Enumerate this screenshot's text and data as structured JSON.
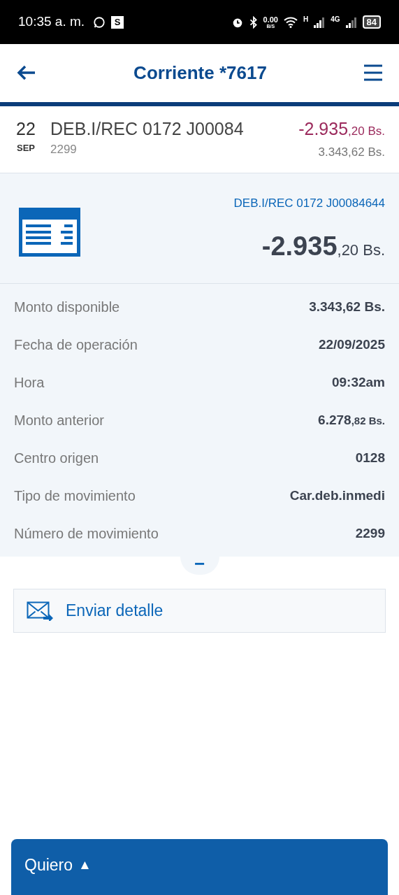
{
  "status_bar": {
    "time": "10:35 a. m.",
    "app_badge": "S",
    "speed": "0.00",
    "speed_unit": "B/S",
    "network_1": "H",
    "network_2": "4G",
    "battery": "84"
  },
  "header": {
    "title": "Corriente *7617"
  },
  "transaction": {
    "day": "22",
    "month": "SEP",
    "description": "DEB.I/REC 0172 J00084",
    "reference": "2299",
    "amount_main": "-2.935",
    "amount_small": ",20 Bs.",
    "balance": "3.343,62 Bs."
  },
  "detail": {
    "title": "DEB.I/REC 0172 J00084644",
    "amount_main": "-2.935",
    "amount_small": ",20 Bs.",
    "rows": [
      {
        "label": "Monto disponible",
        "value": "3.343,62 Bs."
      },
      {
        "label": "Fecha de operación",
        "value": "22/09/2025"
      },
      {
        "label": "Hora",
        "value": "09:32am"
      },
      {
        "label": "Monto anterior",
        "value": "6.278",
        "value_small": ",82 Bs."
      },
      {
        "label": "Centro origen",
        "value": "0128"
      },
      {
        "label": "Tipo de movimiento",
        "value": "Car.deb.inmedi"
      },
      {
        "label": "Número de movimiento",
        "value": "2299"
      }
    ],
    "collapse": "−"
  },
  "send_button": {
    "label": "Enviar detalle"
  },
  "bottom_bar": {
    "label": "Quiero",
    "arrow": "▲"
  }
}
